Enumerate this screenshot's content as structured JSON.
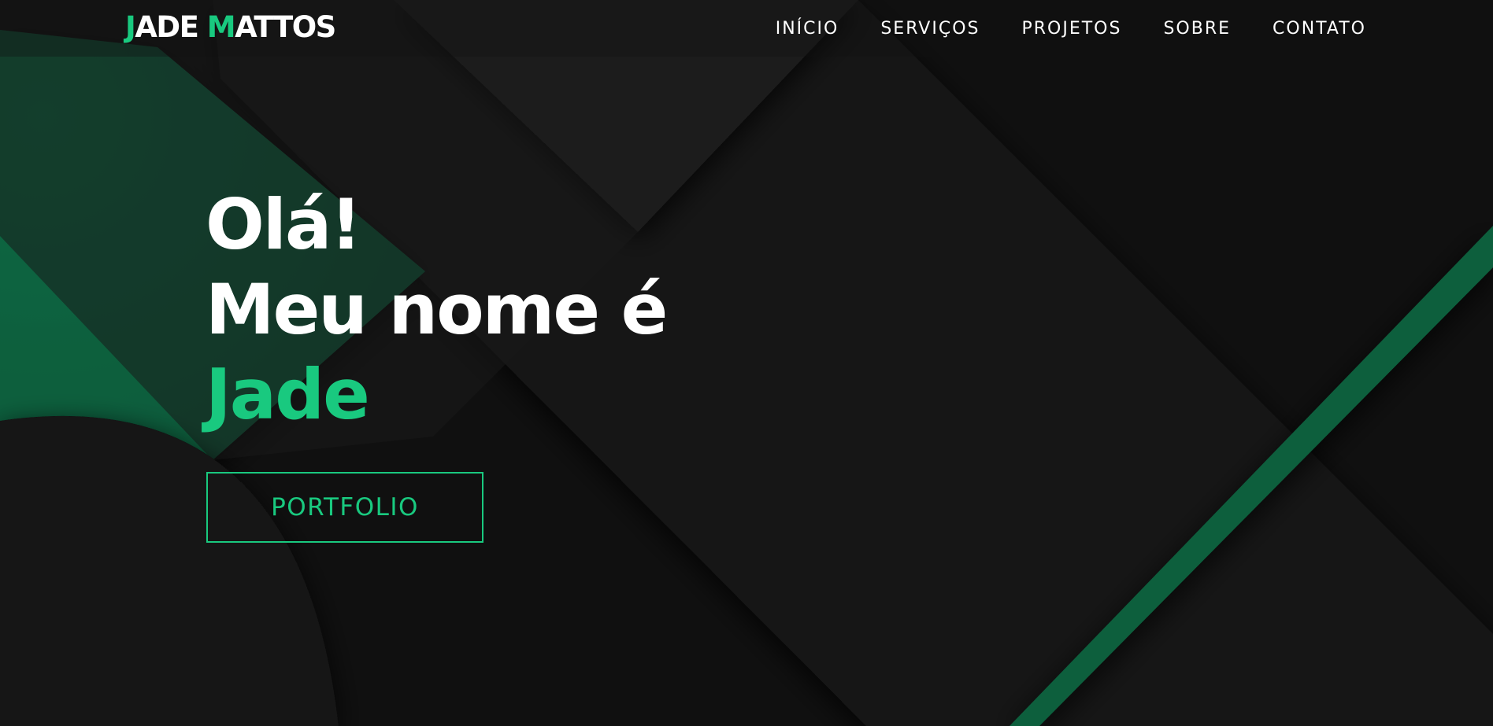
{
  "header": {
    "logo_first_initial": "J",
    "logo_first_rest": "ADE",
    "logo_last_initial": "M",
    "logo_last_rest": "ATTOS"
  },
  "nav": {
    "items": [
      {
        "label": "INÍCIO"
      },
      {
        "label": "SERVIÇOS"
      },
      {
        "label": "PROJETOS"
      },
      {
        "label": "SOBRE"
      },
      {
        "label": "CONTATO"
      }
    ]
  },
  "hero": {
    "greeting": "Olá!",
    "intro": "Meu nome é",
    "name": "Jade",
    "button_label": "PORTFOLIO"
  },
  "colors": {
    "accent": "#19c97f",
    "background": "#0f0f0f",
    "dark_green_shape": "#0f5e3d",
    "text": "#ffffff"
  }
}
